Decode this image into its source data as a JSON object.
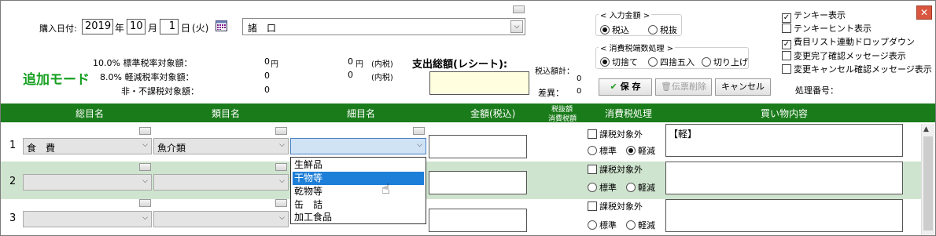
{
  "purchase": {
    "date_label": "購入日付:",
    "year": "2019",
    "year_unit": "年",
    "month": "10",
    "month_unit": "月",
    "day": "1",
    "day_unit": "日",
    "weekday": "(火)",
    "store": "諸　口"
  },
  "mode_title": "追加モード",
  "summary": {
    "row1_label": "10.0% 標準税率対象額：",
    "row1_value": "0",
    "row1_unit": "円",
    "row1_value2": "0",
    "row1_unit2": "円",
    "row1_note": "(内税)",
    "row2_label": "8.0% 軽減税率対象額：",
    "row2_value": "0",
    "row2_value2": "0",
    "row2_note": "(内税)",
    "row3_label": "非・不課税対象額：",
    "row3_value": "0"
  },
  "total": {
    "label": "支出総額(レシート):",
    "tax_total_label": "税込額計：",
    "tax_total_value": "0",
    "diff_label": "差異：",
    "diff_value": "0"
  },
  "input_amount": {
    "title": "< 入力金額 >",
    "opt1": "税込",
    "opt2": "税抜"
  },
  "tax_rounding": {
    "title": "< 消費税端数処理 >",
    "opt1": "切捨て",
    "opt2": "四捨五入",
    "opt3": "切り上げ"
  },
  "buttons": {
    "save": "保 存",
    "delete": "伝票削除",
    "cancel": "キャンセル"
  },
  "process_no_label": "処理番号：",
  "options": {
    "o1": "テンキー表示",
    "o2": "テンキーヒント表示",
    "o3": "費目リスト連動ドロップダウン",
    "o4": "変更完了確認メッセージ表示",
    "o5": "変更キャンセル確認メッセージ表示"
  },
  "columns": {
    "c1": "総目名",
    "c2": "類目名",
    "c3": "細目名",
    "c4": "金額(税込)",
    "c5a": "税抜額",
    "c5b": "消費税額",
    "c6": "消費税処理",
    "c7": "買い物内容"
  },
  "rows": [
    {
      "num": "1",
      "category": "食　費",
      "subcategory": "魚介類",
      "taxfree": "課税対象外",
      "std": "標準",
      "reduced": "軽減",
      "contents": "【軽】"
    },
    {
      "num": "2",
      "taxfree": "課税対象外",
      "std": "標準",
      "reduced": "軽減"
    },
    {
      "num": "3",
      "taxfree": "課税対象外",
      "std": "標準",
      "reduced": "軽減"
    }
  ],
  "dropdown_items": [
    "生鮮品",
    "干物等",
    "乾物等",
    "缶　詰",
    "加工食品"
  ],
  "close_symbol": "✕"
}
